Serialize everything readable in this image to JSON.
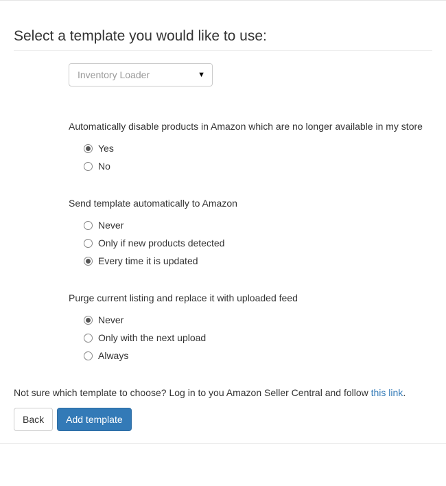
{
  "title": "Select a template you would like to use:",
  "template_select": {
    "value": "Inventory Loader"
  },
  "groups": [
    {
      "label": "Automatically disable products in Amazon which are no longer available in my store",
      "options": [
        {
          "label": "Yes",
          "checked": true
        },
        {
          "label": "No",
          "checked": false
        }
      ]
    },
    {
      "label": "Send template automatically to Amazon",
      "options": [
        {
          "label": "Never",
          "checked": false
        },
        {
          "label": "Only if new products detected",
          "checked": false
        },
        {
          "label": "Every time it is updated",
          "checked": true
        }
      ]
    },
    {
      "label": "Purge current listing and replace it with uploaded feed",
      "options": [
        {
          "label": "Never",
          "checked": true
        },
        {
          "label": "Only with the next upload",
          "checked": false
        },
        {
          "label": "Always",
          "checked": false
        }
      ]
    }
  ],
  "help": {
    "prefix": "Not sure which template to choose? Log in to you Amazon Seller Central and follow ",
    "link_text": "this link",
    "suffix": "."
  },
  "buttons": {
    "back": "Back",
    "add": "Add template"
  }
}
